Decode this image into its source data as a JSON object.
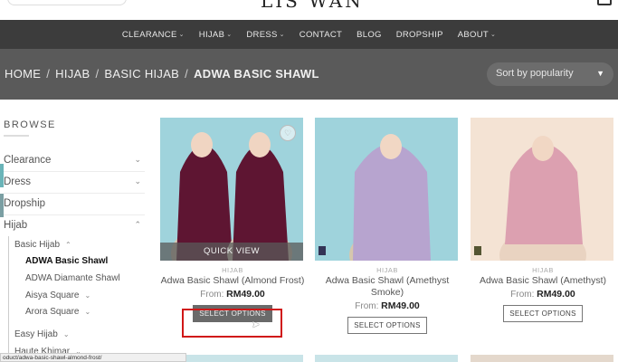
{
  "nav": {
    "items": [
      {
        "label": "CLEARANCE",
        "dropdown": true
      },
      {
        "label": "HIJAB",
        "dropdown": true
      },
      {
        "label": "DRESS",
        "dropdown": true
      },
      {
        "label": "CONTACT",
        "dropdown": false
      },
      {
        "label": "BLOG",
        "dropdown": false
      },
      {
        "label": "DROPSHIP",
        "dropdown": false
      },
      {
        "label": "ABOUT",
        "dropdown": true
      }
    ],
    "chevron": "⌄"
  },
  "breadcrumb": {
    "home": "HOME",
    "hijab": "HIJAB",
    "basic_hijab": "BASIC HIJAB",
    "current": "ADWA BASIC SHAWL",
    "separator": "/"
  },
  "sort": {
    "selected": "Sort by popularity"
  },
  "sidebar": {
    "heading": "BROWSE",
    "categories": {
      "clearance": "Clearance",
      "dress": "Dress",
      "dropship": "Dropship",
      "hijab": "Hijab"
    },
    "sub": {
      "basic_hijab": "Basic Hijab",
      "adwa_basic_shawl": "ADWA Basic Shawl",
      "adwa_diamante_shawl": "ADWA Diamante Shawl",
      "aisya_square": "Aisya Square",
      "arora_square": "Arora Square",
      "easy_hijab": "Easy Hijab",
      "haute_khimar": "Haute Khimar"
    }
  },
  "status_url": "oduct/adwa-basic-shawl-almond-frost/",
  "products": [
    {
      "category": "HIJAB",
      "name": "Adwa Basic Shawl (Almond Frost)",
      "price_prefix": "From:",
      "price": "RM49.00",
      "button": "SELECT OPTIONS",
      "quick_view": "QUICK VIEW",
      "shawl_color": "#5e1532",
      "bg_color": "#9fd3dc"
    },
    {
      "category": "HIJAB",
      "name": "Adwa Basic Shawl (Amethyst Smoke)",
      "price_prefix": "From:",
      "price": "RM49.00",
      "button": "SELECT OPTIONS",
      "shawl_color": "#b7a4cf",
      "bg_color": "#9fd3dc"
    },
    {
      "category": "HIJAB",
      "name": "Adwa Basic Shawl (Amethyst)",
      "price_prefix": "From:",
      "price": "RM49.00",
      "button": "SELECT OPTIONS",
      "shawl_color": "#dca0b0",
      "bg_color": "#f4e3d4"
    }
  ],
  "colors": {
    "nav_bg": "#3c3c3c",
    "title_bg": "#5a5a5a",
    "highlight_box": "#d01717",
    "sidebar_teal": "#6ab4b8"
  }
}
